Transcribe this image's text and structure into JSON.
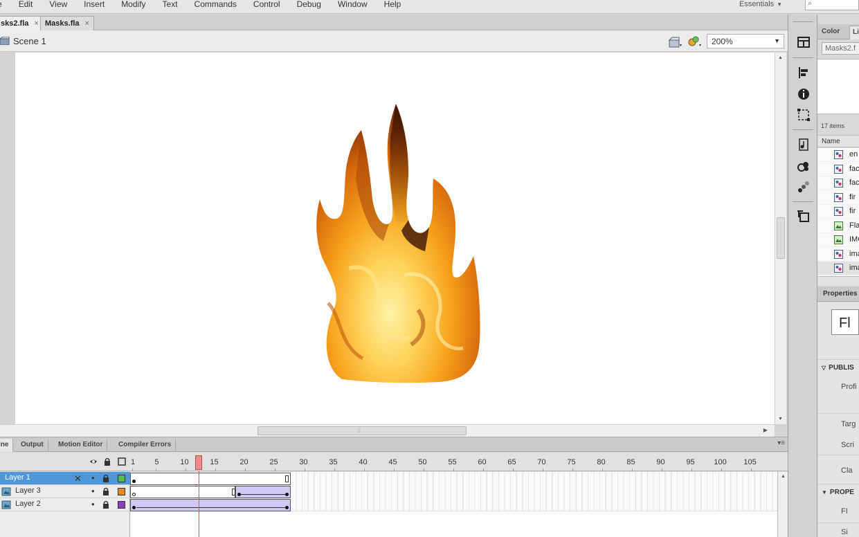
{
  "menubar": {
    "items": [
      "e",
      "Edit",
      "View",
      "Insert",
      "Modify",
      "Text",
      "Commands",
      "Control",
      "Debug",
      "Window",
      "Help"
    ],
    "workspace": "Essentials",
    "search_icon": "search-icon"
  },
  "doc_tabs": [
    {
      "label": "sks2.fla",
      "close": "×",
      "active": true
    },
    {
      "label": "Masks.fla",
      "close": "×",
      "active": false
    }
  ],
  "scenebar": {
    "scene_label": "Scene 1",
    "zoom": "200%"
  },
  "timeline": {
    "tabs": [
      "ine",
      "Output",
      "Motion Editor",
      "Compiler Errors"
    ],
    "ruler": [
      "1",
      "5",
      "10",
      "15",
      "20",
      "25",
      "30",
      "35",
      "40",
      "45",
      "50",
      "55",
      "60",
      "65",
      "70",
      "75",
      "80",
      "85",
      "90",
      "95",
      "100",
      "105"
    ],
    "current_frame": 12,
    "layers": [
      {
        "name": "Layer 1",
        "selected": true,
        "color": "#4fbf4f"
      },
      {
        "name": "Layer 3",
        "selected": false,
        "color": "#e08a2a"
      },
      {
        "name": "Layer 2",
        "selected": false,
        "color": "#8b3fc0"
      }
    ]
  },
  "right_panel": {
    "tabs": [
      "Color",
      "Li"
    ],
    "library_doc": "Masks2.f",
    "item_count": "17 items",
    "name_header": "Name",
    "items": [
      {
        "name": "en",
        "icon": "movieclip-icon",
        "selected": false
      },
      {
        "name": "fac",
        "icon": "movieclip-icon",
        "selected": false
      },
      {
        "name": "fac",
        "icon": "movieclip-icon",
        "selected": false
      },
      {
        "name": "fir",
        "icon": "movieclip-icon",
        "selected": false
      },
      {
        "name": "fir",
        "icon": "movieclip-icon",
        "selected": false
      },
      {
        "name": "Fla",
        "icon": "bitmap-icon",
        "selected": false
      },
      {
        "name": "IMG",
        "icon": "bitmap-icon",
        "selected": false
      },
      {
        "name": "ima",
        "icon": "movieclip-icon",
        "selected": false
      },
      {
        "name": "ima",
        "icon": "movieclip-icon",
        "selected": true
      }
    ],
    "properties_tab": "Properties",
    "fl_badge": "Fl",
    "sections": {
      "publish": "PUBLIS",
      "properties": "PROPE"
    },
    "labels": {
      "profile": "Profi",
      "target": "Targ",
      "script": "Scri",
      "class": "Cla",
      "fps": "FI",
      "size": "Si"
    }
  }
}
